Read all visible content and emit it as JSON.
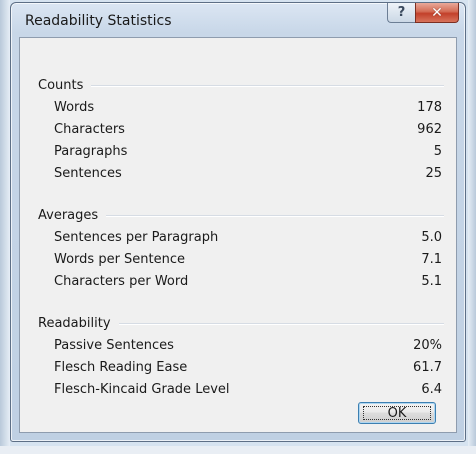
{
  "window": {
    "title": "Readability Statistics",
    "help_icon": "question-mark-icon",
    "close_icon": "close-x-icon",
    "help_glyph": "?",
    "close_glyph": "✕"
  },
  "groups": [
    {
      "label": "Counts",
      "rows": [
        {
          "label": "Words",
          "value": "178"
        },
        {
          "label": "Characters",
          "value": "962"
        },
        {
          "label": "Paragraphs",
          "value": "5"
        },
        {
          "label": "Sentences",
          "value": "25"
        }
      ]
    },
    {
      "label": "Averages",
      "rows": [
        {
          "label": "Sentences per Paragraph",
          "value": "5.0"
        },
        {
          "label": "Words per Sentence",
          "value": "7.1"
        },
        {
          "label": "Characters per Word",
          "value": "5.1"
        }
      ]
    },
    {
      "label": "Readability",
      "rows": [
        {
          "label": "Passive Sentences",
          "value": "20%"
        },
        {
          "label": "Flesch Reading Ease",
          "value": "61.7"
        },
        {
          "label": "Flesch-Kincaid Grade Level",
          "value": "6.4"
        }
      ]
    }
  ],
  "ok_label": "OK",
  "colors": {
    "close_button": "#c2402a",
    "ok_border": "#3c7fb1",
    "client_background": "#f0f0f0"
  }
}
